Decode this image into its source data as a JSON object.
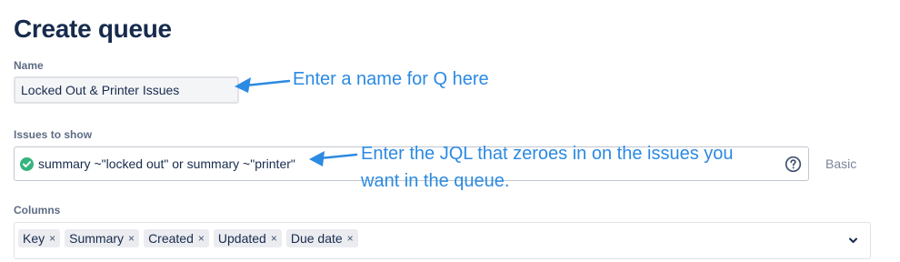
{
  "page": {
    "title": "Create queue"
  },
  "name_field": {
    "label": "Name",
    "value": "Locked Out & Printer Issues"
  },
  "issues_field": {
    "label": "Issues to show",
    "jql": "summary ~\"locked out\" or summary ~\"printer\"",
    "valid_icon": "check-circle-icon",
    "help_icon": "question-circle-icon",
    "basic_link": "Basic"
  },
  "columns_field": {
    "label": "Columns",
    "chips": [
      {
        "label": "Key",
        "remove": "×"
      },
      {
        "label": "Summary",
        "remove": "×"
      },
      {
        "label": "Created",
        "remove": "×"
      },
      {
        "label": "Updated",
        "remove": "×"
      },
      {
        "label": "Due date",
        "remove": "×"
      }
    ],
    "dropdown_icon": "chevron-down-icon"
  },
  "annotations": {
    "name_hint": "Enter a name for Q here",
    "jql_hint_line1": "Enter the JQL that zeroes in on the issues you",
    "jql_hint_line2": "want in the queue."
  },
  "colors": {
    "accent_annotation": "#2c8ae2",
    "valid_green": "#36b37e",
    "heading": "#172b4d",
    "label": "#5e6c84",
    "link_muted": "#7a869a"
  }
}
